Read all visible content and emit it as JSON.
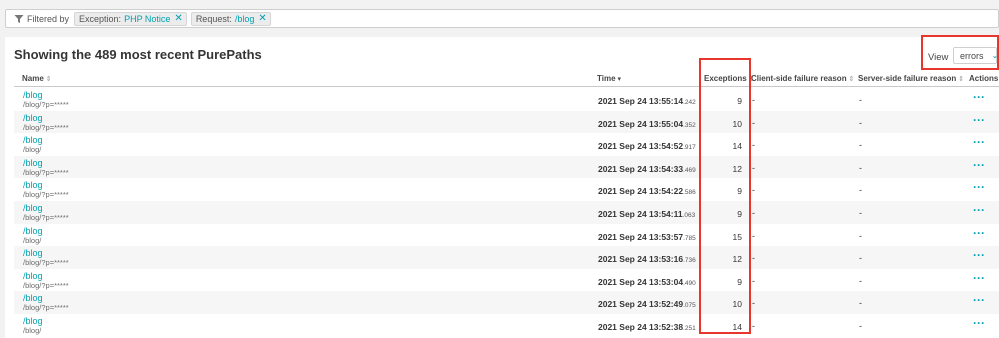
{
  "filter": {
    "label": "Filtered by",
    "chips": [
      {
        "key": "Exception:",
        "value": "PHP Notice"
      },
      {
        "key": "Request:",
        "value": "/blog"
      }
    ]
  },
  "panel": {
    "title": "Showing the 489 most recent PurePaths",
    "view_label": "View",
    "view_value": "errors"
  },
  "columns": {
    "name": "Name",
    "time": "Time",
    "exceptions": "Exceptions",
    "client": "Client-side failure reason",
    "server": "Server-side failure reason",
    "actions": "Actions"
  },
  "rows": [
    {
      "name": "/blog",
      "path": "/blog/?p=*****",
      "time": "2021 Sep 24 13:55:14",
      "ms": ".242",
      "exceptions": "9",
      "client": "-",
      "server": "-"
    },
    {
      "name": "/blog",
      "path": "/blog/?p=*****",
      "time": "2021 Sep 24 13:55:04",
      "ms": ".352",
      "exceptions": "10",
      "client": "-",
      "server": "-"
    },
    {
      "name": "/blog",
      "path": "/blog/",
      "time": "2021 Sep 24 13:54:52",
      "ms": ".917",
      "exceptions": "14",
      "client": "-",
      "server": "-"
    },
    {
      "name": "/blog",
      "path": "/blog/?p=*****",
      "time": "2021 Sep 24 13:54:33",
      "ms": ".469",
      "exceptions": "12",
      "client": "-",
      "server": "-"
    },
    {
      "name": "/blog",
      "path": "/blog/?p=*****",
      "time": "2021 Sep 24 13:54:22",
      "ms": ".586",
      "exceptions": "9",
      "client": "-",
      "server": "-"
    },
    {
      "name": "/blog",
      "path": "/blog/?p=*****",
      "time": "2021 Sep 24 13:54:11",
      "ms": ".063",
      "exceptions": "9",
      "client": "-",
      "server": "-"
    },
    {
      "name": "/blog",
      "path": "/blog/",
      "time": "2021 Sep 24 13:53:57",
      "ms": ".785",
      "exceptions": "15",
      "client": "-",
      "server": "-"
    },
    {
      "name": "/blog",
      "path": "/blog/?p=*****",
      "time": "2021 Sep 24 13:53:16",
      "ms": ".736",
      "exceptions": "12",
      "client": "-",
      "server": "-"
    },
    {
      "name": "/blog",
      "path": "/blog/?p=*****",
      "time": "2021 Sep 24 13:53:04",
      "ms": ".490",
      "exceptions": "9",
      "client": "-",
      "server": "-"
    },
    {
      "name": "/blog",
      "path": "/blog/?p=*****",
      "time": "2021 Sep 24 13:52:49",
      "ms": ".075",
      "exceptions": "10",
      "client": "-",
      "server": "-"
    },
    {
      "name": "/blog",
      "path": "/blog/",
      "time": "2021 Sep 24 13:52:38",
      "ms": ".251",
      "exceptions": "14",
      "client": "-",
      "server": "-"
    }
  ],
  "actions_glyph": "···",
  "colors": {
    "accent": "#00a1b2",
    "highlight": "#e8362c"
  }
}
